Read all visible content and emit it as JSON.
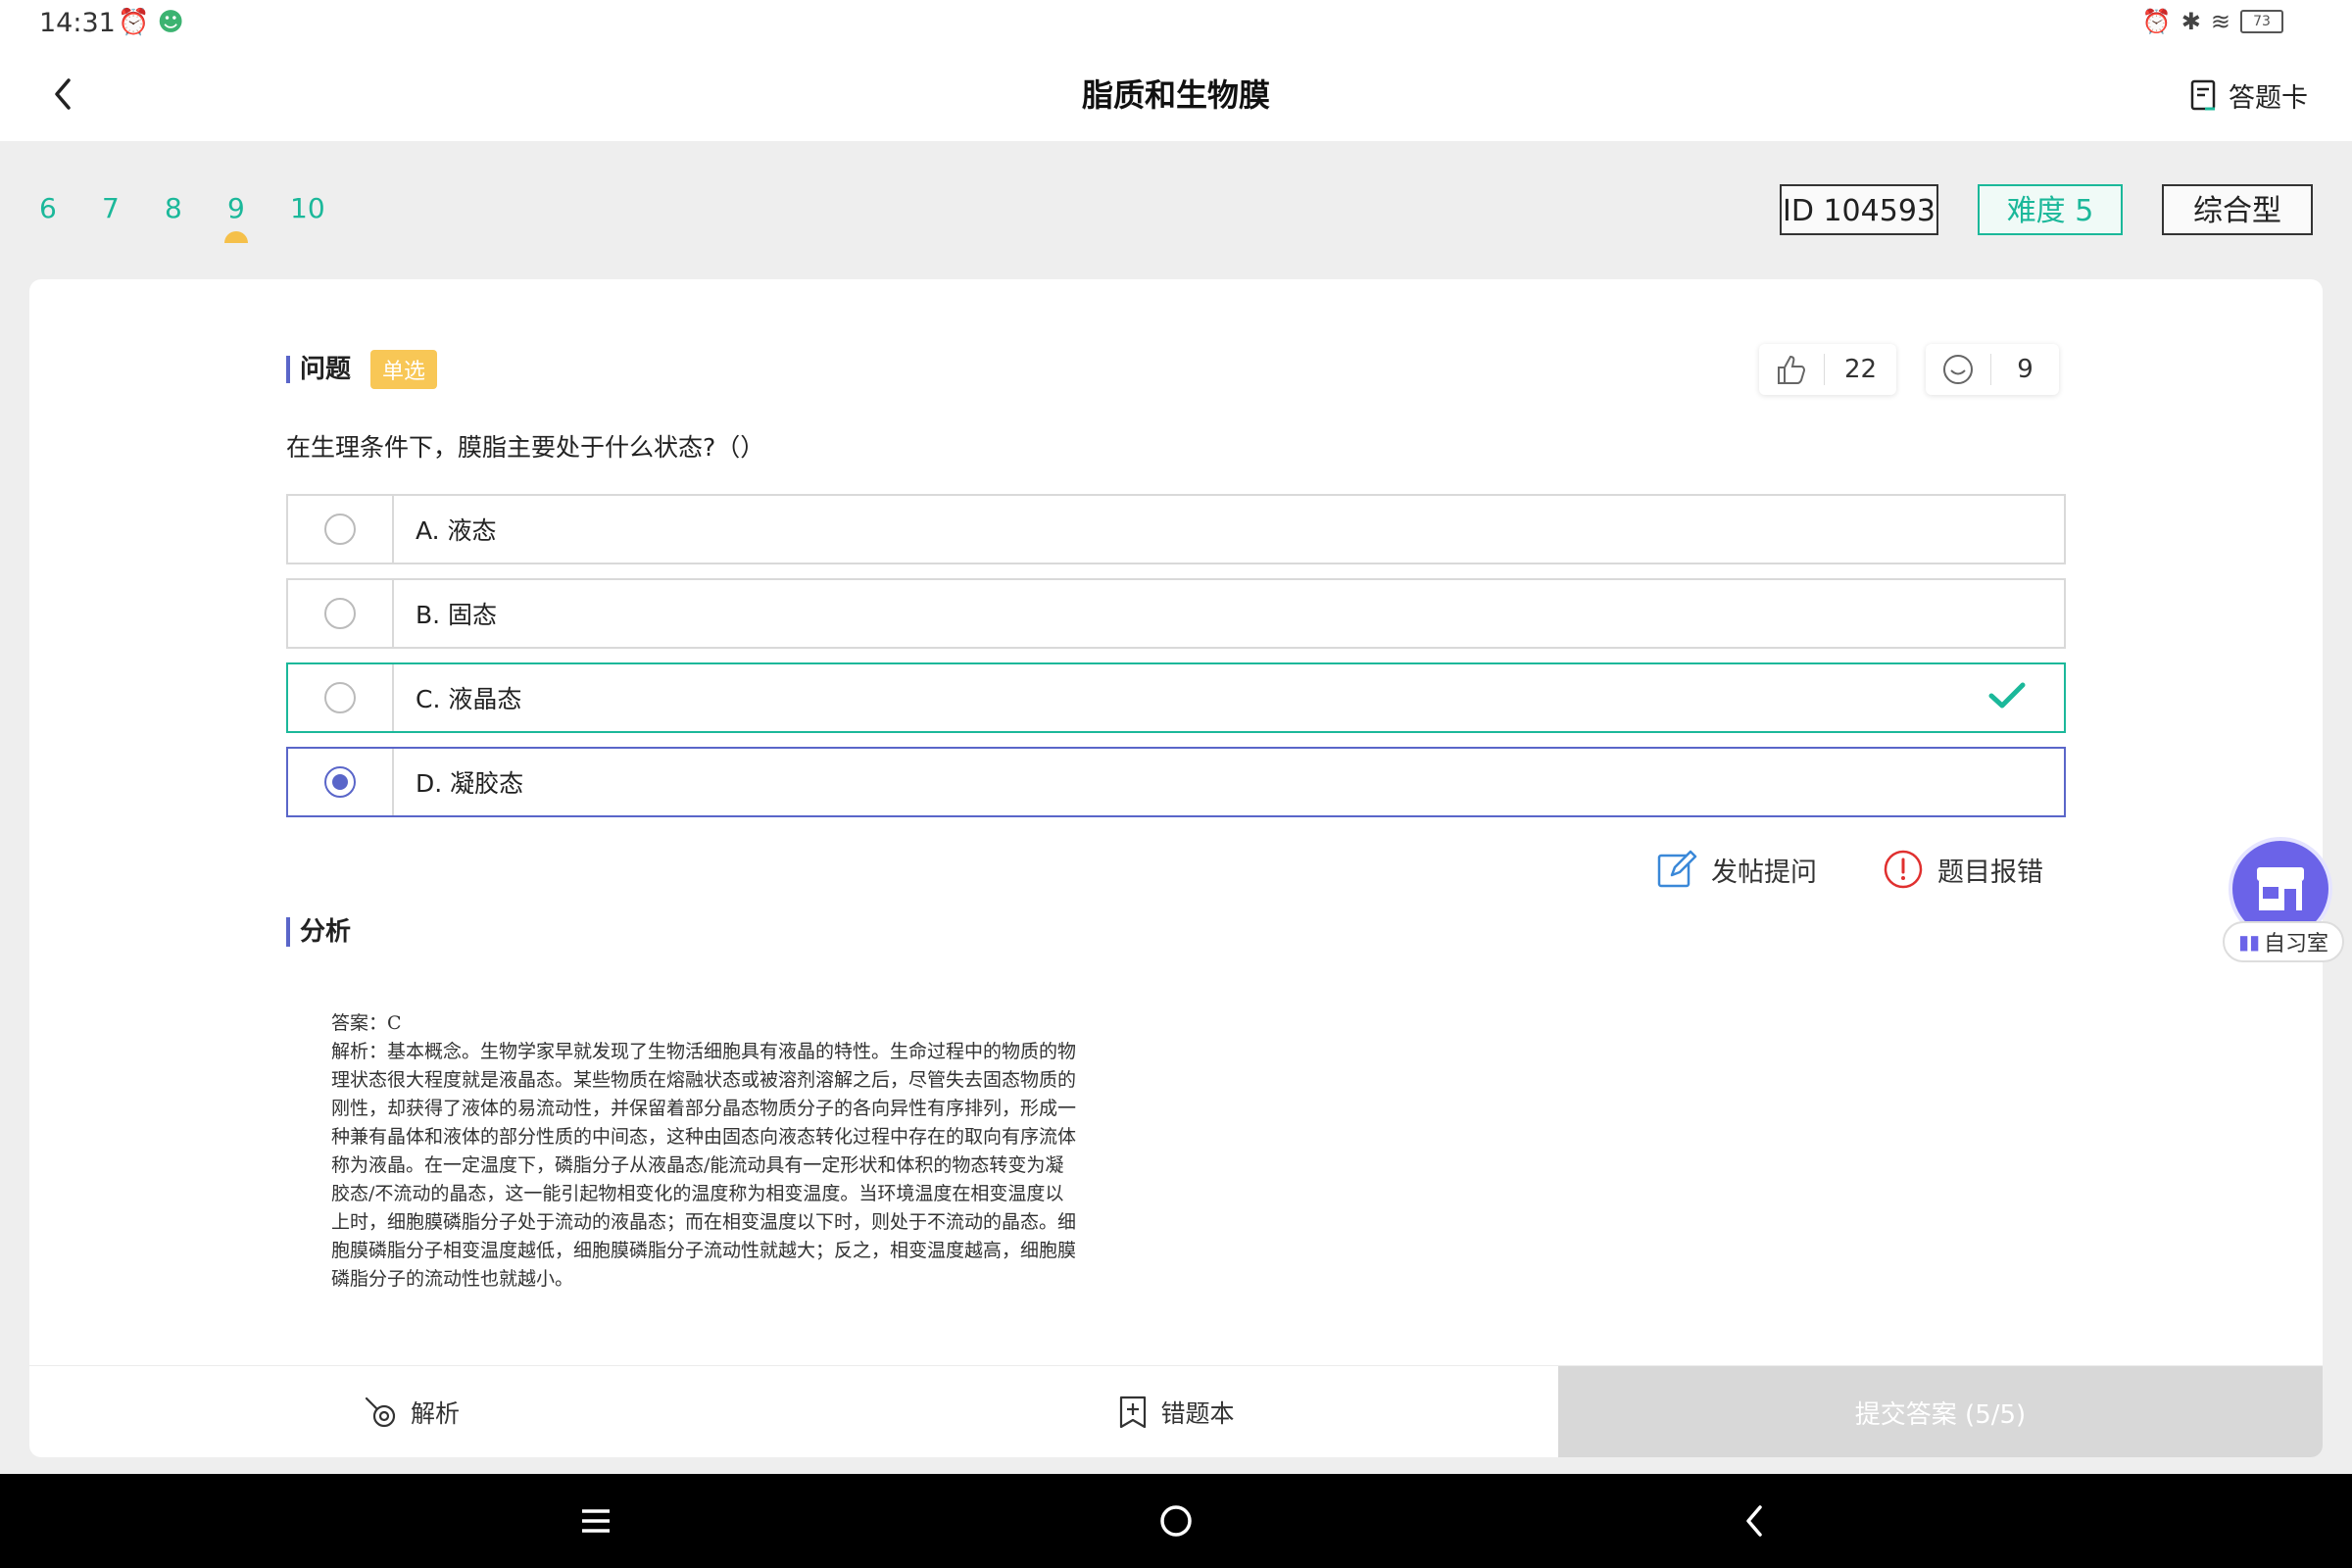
{
  "status": {
    "time": "14:31",
    "battery": "73"
  },
  "header": {
    "title": "脂质和生物膜",
    "answer_card_label": "答题卡"
  },
  "question_nav": {
    "numbers": [
      "6",
      "7",
      "8",
      "9",
      "10"
    ],
    "active": "9"
  },
  "tags": {
    "id": "ID 104593",
    "difficulty": "难度 5",
    "type": "综合型"
  },
  "question": {
    "section_label": "问题",
    "type_badge": "单选",
    "likes": "22",
    "reactions": "9",
    "text": "在生理条件下，膜脂主要处于什么状态?（）",
    "options": [
      {
        "label": "A. 液态",
        "state": "normal"
      },
      {
        "label": "B. 固态",
        "state": "normal"
      },
      {
        "label": "C. 液晶态",
        "state": "correct"
      },
      {
        "label": "D. 凝胶态",
        "state": "selected"
      }
    ]
  },
  "actions": {
    "post_question": "发帖提问",
    "report_error": "题目报错"
  },
  "analysis": {
    "section_label": "分析",
    "answer_line": "答案：C",
    "lines": [
      "解析：基本概念。生物学家早就发现了生物活细胞具有液晶的特性。生命过程中的物质的物",
      "理状态很大程度就是液晶态。某些物质在熔融状态或被溶剂溶解之后，尽管失去固态物质的",
      "刚性，却获得了液体的易流动性，并保留着部分晶态物质分子的各向异性有序排列，形成一",
      "种兼有晶体和液体的部分性质的中间态，这种由固态向液态转化过程中存在的取向有序流体",
      "称为液晶。在一定温度下，磷脂分子从液晶态/能流动具有一定形状和体积的物态转变为凝",
      "胶态/不流动的晶态，这一能引起物相变化的温度称为相变温度。当环境温度在相变温度以",
      "上时，细胞膜磷脂分子处于流动的液晶态；而在相变温度以下时，则处于不流动的晶态。细",
      "胞膜磷脂分子相变温度越低，细胞膜磷脂分子流动性就越大；反之，相变温度越高，细胞膜",
      "磷脂分子的流动性也就越小。"
    ]
  },
  "bottom": {
    "analysis_label": "解析",
    "wrong_book_label": "错题本",
    "submit_label": "提交答案 (5/5)"
  },
  "floating": {
    "label": "自习室"
  },
  "colors": {
    "accent_green": "#1bb89a",
    "accent_purple": "#5a66c9",
    "badge_yellow": "#f8c756",
    "error_red": "#e0302f"
  }
}
